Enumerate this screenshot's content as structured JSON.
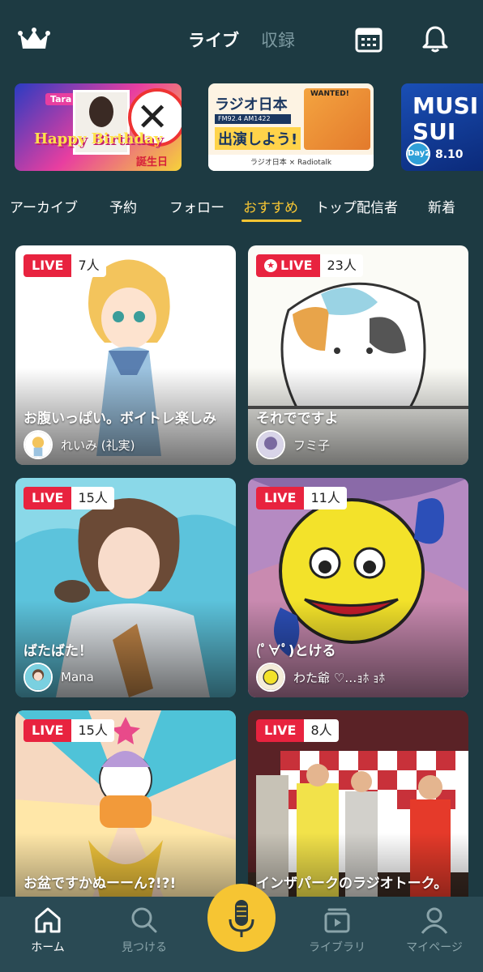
{
  "header": {
    "tabs": [
      {
        "label": "ライブ",
        "active": true
      },
      {
        "label": "収録",
        "active": false
      }
    ],
    "icons": [
      "crown-icon",
      "calendar-icon",
      "bell-icon"
    ]
  },
  "banners": [
    {
      "tag": "Tara",
      "text": "Happy Birthday",
      "sub": "誕生日"
    },
    {
      "title": "ラジオ日本",
      "freq": "FM92.4  AM1422",
      "cta": "出演しよう!",
      "wanted": "WANTED!",
      "footer": "ラジオ日本 × Radiotalk"
    },
    {
      "title": "MUSI SUI",
      "day": "Day2",
      "date": "8.10"
    }
  ],
  "categories": {
    "items": [
      "アーカイブ",
      "予約",
      "フォロー",
      "おすすめ",
      "トップ配信者",
      "新着"
    ],
    "active": "おすすめ"
  },
  "cards": [
    {
      "live": "LIVE",
      "viewers": "7人",
      "title": "お腹いっぱい。ボイトレ楽しみ",
      "author": "れいみ (礼実)",
      "featured": false
    },
    {
      "live": "LIVE",
      "viewers": "23人",
      "title": "それでですよ",
      "author": "フミ子",
      "featured": true
    },
    {
      "live": "LIVE",
      "viewers": "15人",
      "title": "ばたばた！",
      "author": "Mana",
      "featured": false
    },
    {
      "live": "LIVE",
      "viewers": "11人",
      "title": "(ﾟ∀ﾟ)とける",
      "author": "わた爺 ♡…ｮﾎ ｮﾎ",
      "featured": false
    },
    {
      "live": "LIVE",
      "viewers": "15人",
      "title": "お盆ですかぬーーん?!?!",
      "author": "",
      "featured": false
    },
    {
      "live": "LIVE",
      "viewers": "8人",
      "title": "インザパークのラジオトーク。",
      "author": "",
      "featured": false
    }
  ],
  "nav": [
    {
      "label": "ホーム",
      "icon": "home-icon",
      "active": true
    },
    {
      "label": "見つける",
      "icon": "search-icon",
      "active": false
    },
    {
      "label": "",
      "icon": "mic-icon",
      "active": false
    },
    {
      "label": "ライブラリ",
      "icon": "library-icon",
      "active": false
    },
    {
      "label": "マイページ",
      "icon": "profile-icon",
      "active": false
    }
  ],
  "colors": {
    "background": "#1d3a42",
    "accent": "#f6c533",
    "live": "#e8233f",
    "nav": "#2a4a54"
  }
}
